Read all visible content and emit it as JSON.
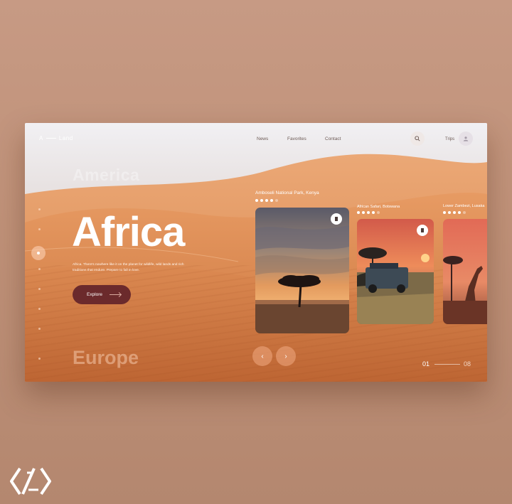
{
  "header": {
    "logo_left": "A",
    "logo_right": "Land",
    "nav": [
      "News",
      "Favorites",
      "Contact"
    ],
    "trips_label": "Trips"
  },
  "icons": {
    "search": "search-icon",
    "avatar": "user-avatar-icon",
    "bookmark": "bookmark-icon",
    "prev": "chevron-left-icon",
    "next": "chevron-right-icon",
    "brand": "brand-logo-icon"
  },
  "hero": {
    "prev_destination": "America",
    "title": "Africa",
    "next_destination": "Europe",
    "description": "Africa. There's nowhere like it on the planet for wildlife, wild lands and rich traditions that endure. Prepare to fall in love.",
    "explore_label": "Explore"
  },
  "destinations": [
    {
      "name": "Amboseli National Park, Kenya",
      "rating": 4,
      "max_rating": 5
    },
    {
      "name": "African Safari, Botswana",
      "rating": 4,
      "max_rating": 5
    },
    {
      "name": "Lower Zambezi, Lusaka",
      "rating": 4,
      "max_rating": 5
    }
  ],
  "pagination": {
    "prev_symbol": "‹",
    "next_symbol": "›",
    "current": "01",
    "total": "08"
  },
  "colors": {
    "accent": "#6b2a2c",
    "background": "#c79a84",
    "sand": "#d9844a"
  }
}
